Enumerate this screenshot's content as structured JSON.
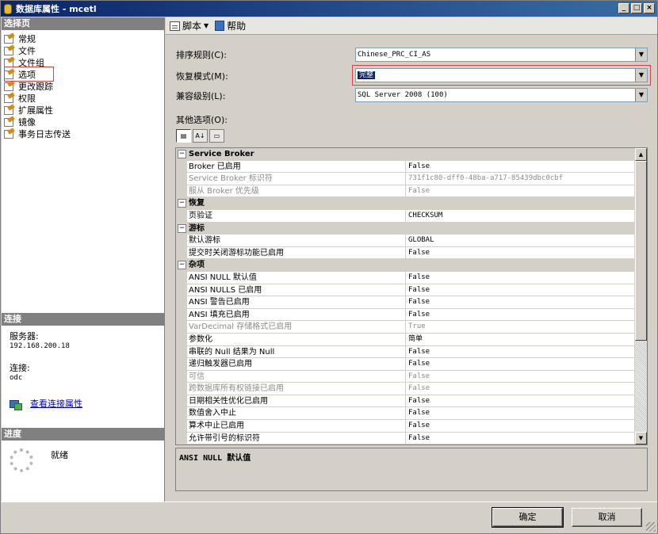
{
  "window": {
    "title": "数据库属性 - mcetl",
    "controls": [
      "_",
      "□",
      "×"
    ]
  },
  "left": {
    "select_page_header": "选择页",
    "nav_items": [
      {
        "label": "常规"
      },
      {
        "label": "文件"
      },
      {
        "label": "文件组"
      },
      {
        "label": "选项",
        "selected": true
      },
      {
        "label": "更改跟踪"
      },
      {
        "label": "权限"
      },
      {
        "label": "扩展属性"
      },
      {
        "label": "镜像"
      },
      {
        "label": "事务日志传送"
      }
    ],
    "connection_header": "连接",
    "server_label": "服务器:",
    "server_value": "192.168.200.18",
    "connection_label": "连接:",
    "connection_value": "odc",
    "view_connection_link": "查看连接属性",
    "progress_header": "进度",
    "progress_status": "就绪"
  },
  "toolbar": {
    "script_label": "脚本",
    "help_label": "帮助"
  },
  "fields": {
    "collation_label": "排序规则(C):",
    "collation_value": "Chinese_PRC_CI_AS",
    "recovery_label": "恢复模式(M):",
    "recovery_value": "完整",
    "compat_label": "兼容级别(L):",
    "compat_value": "SQL Server 2008 (100)",
    "other_options_label": "其他选项(O):"
  },
  "property_grid": {
    "rows": [
      {
        "type": "cat",
        "name": "Service Broker"
      },
      {
        "type": "prop",
        "name": "Broker 已启用",
        "value": "False"
      },
      {
        "type": "prop",
        "name": "Service Broker 标识符",
        "value": "731f1c80-dff0-48ba-a717-85439dbc0cbf",
        "disabled": true
      },
      {
        "type": "prop",
        "name": "服从 Broker 优先级",
        "value": "False",
        "disabled": true
      },
      {
        "type": "cat",
        "name": "恢复"
      },
      {
        "type": "prop",
        "name": "页验证",
        "value": "CHECKSUM"
      },
      {
        "type": "cat",
        "name": "游标"
      },
      {
        "type": "prop",
        "name": "默认游标",
        "value": "GLOBAL"
      },
      {
        "type": "prop",
        "name": "提交时关闭游标功能已启用",
        "value": "False"
      },
      {
        "type": "cat",
        "name": "杂项"
      },
      {
        "type": "prop",
        "name": "ANSI NULL 默认值",
        "value": "False",
        "selected": true
      },
      {
        "type": "prop",
        "name": "ANSI NULLS 已启用",
        "value": "False"
      },
      {
        "type": "prop",
        "name": "ANSI 警告已启用",
        "value": "False"
      },
      {
        "type": "prop",
        "name": "ANSI 填充已启用",
        "value": "False"
      },
      {
        "type": "prop",
        "name": "VarDecimal 存储格式已启用",
        "value": "True",
        "disabled": true
      },
      {
        "type": "prop",
        "name": "参数化",
        "value": "简单"
      },
      {
        "type": "prop",
        "name": "串联的 Null 结果为 Null",
        "value": "False"
      },
      {
        "type": "prop",
        "name": "递归触发器已启用",
        "value": "False"
      },
      {
        "type": "prop",
        "name": "可信",
        "value": "False",
        "disabled": true
      },
      {
        "type": "prop",
        "name": "跨数据库所有权链接已启用",
        "value": "False",
        "disabled": true
      },
      {
        "type": "prop",
        "name": "日期相关性优化已启用",
        "value": "False"
      },
      {
        "type": "prop",
        "name": "数值舍入中止",
        "value": "False"
      },
      {
        "type": "prop",
        "name": "算术中止已启用",
        "value": "False"
      },
      {
        "type": "prop",
        "name": "允许带引号的标识符",
        "value": "False"
      }
    ]
  },
  "description": {
    "text": "ANSI NULL 默认值"
  },
  "buttons": {
    "ok": "确定",
    "cancel": "取消"
  }
}
